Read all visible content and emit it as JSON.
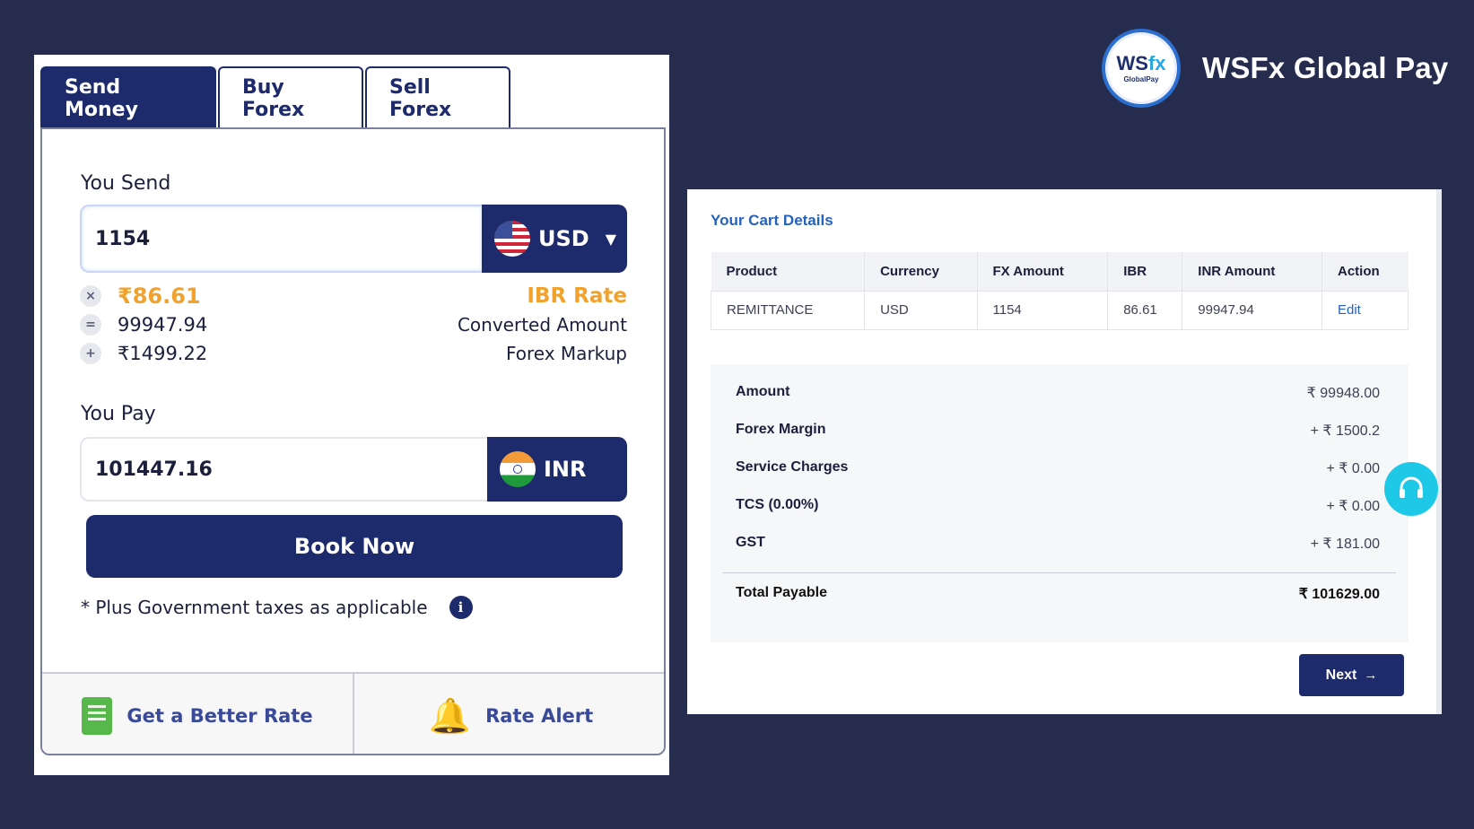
{
  "brand": {
    "name": "WSFx Global Pay",
    "logo_main": "WS",
    "logo_accent": "fx",
    "logo_sub": "GlobalPay"
  },
  "tabs": [
    {
      "label": "Send Money",
      "active": true
    },
    {
      "label": "Buy Forex",
      "active": false
    },
    {
      "label": "Sell Forex",
      "active": false
    }
  ],
  "send": {
    "label": "You Send",
    "amount": "1154",
    "currency": "USD",
    "flag_icon": "us-flag-icon"
  },
  "calc": {
    "rate_value": "₹86.61",
    "rate_label": "IBR Rate",
    "converted_value": "99947.94",
    "converted_label": "Converted Amount",
    "markup_value": "₹1499.22",
    "markup_label": "Forex Markup",
    "op_multiply": "×",
    "op_equals": "=",
    "op_plus": "+"
  },
  "pay": {
    "label": "You Pay",
    "amount": "101447.16",
    "currency": "INR",
    "flag_icon": "india-flag-icon"
  },
  "book_button": "Book Now",
  "taxes_note": "* Plus Government taxes as applicable",
  "info_glyph": "i",
  "bottom": {
    "better_rate": "Get a Better Rate",
    "rate_alert": "Rate Alert",
    "bell_glyph": "🔔"
  },
  "cart": {
    "title": "Your Cart Details",
    "columns": [
      "Product",
      "Currency",
      "FX Amount",
      "IBR",
      "INR Amount",
      "Action"
    ],
    "rows": [
      {
        "product": "REMITTANCE",
        "currency": "USD",
        "fx_amount": "1154",
        "ibr": "86.61",
        "inr_amount": "99947.94",
        "action": "Edit"
      }
    ],
    "summary": [
      {
        "key": "Amount",
        "value": "₹ 99948.00"
      },
      {
        "key": "Forex Margin",
        "value": "+ ₹ 1500.2"
      },
      {
        "key": "Service Charges",
        "value": "+ ₹ 0.00"
      },
      {
        "key": "TCS (0.00%)",
        "value": "+ ₹ 0.00"
      },
      {
        "key": "GST",
        "value": "+ ₹ 181.00"
      }
    ],
    "total": {
      "key": "Total Payable",
      "value": "₹ 101629.00"
    },
    "next_label": "Next",
    "next_arrow": "→"
  },
  "colors": {
    "background": "#252c4d",
    "primary": "#1d2a6b",
    "accent_orange": "#f0a22d",
    "link_blue": "#2462c0",
    "support_cyan": "#1ec9e8"
  }
}
